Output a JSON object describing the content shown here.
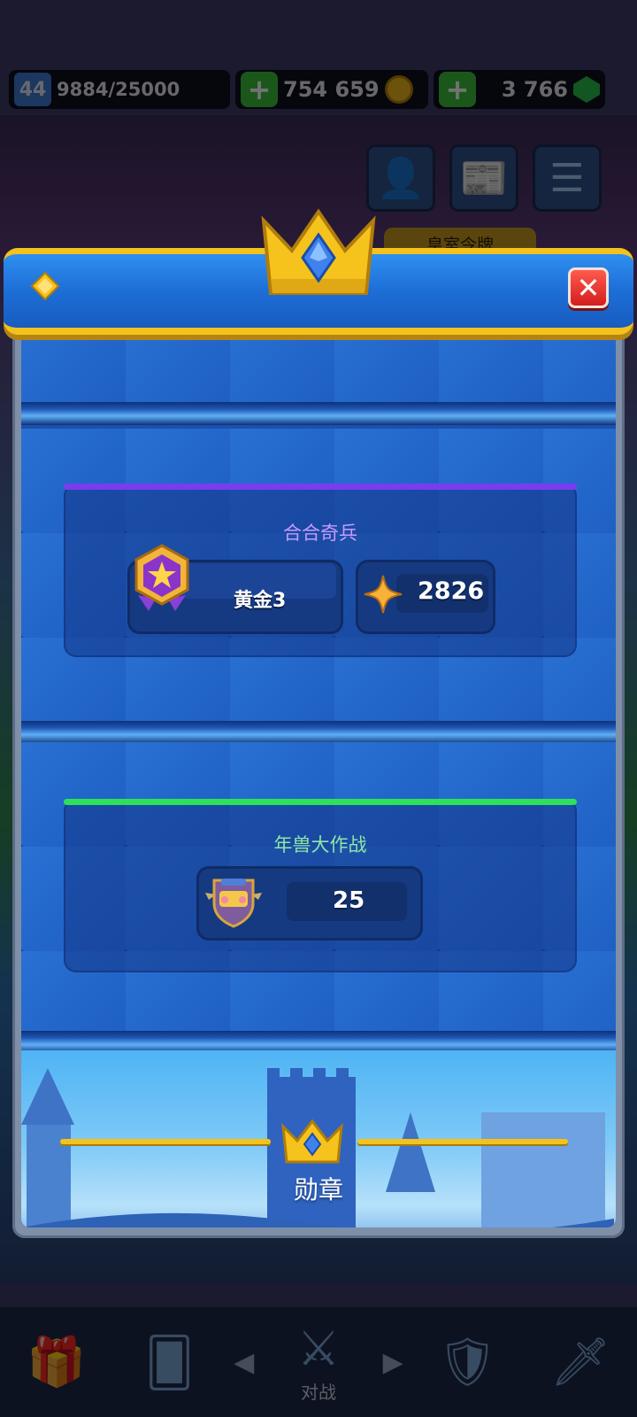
{
  "hud": {
    "level": "44",
    "xp": "9884/25000",
    "gold": "754 659",
    "gems": "3 766",
    "plus_label": "+",
    "plus_label_2": "+"
  },
  "background": {
    "tab_label": "皇室令牌",
    "nav_battle_label": "对战"
  },
  "icons": {
    "header": "diamond-gem-icon",
    "crown": "crown-icon",
    "close": "close-icon",
    "medal": "star-medal-icon",
    "trophy_star": "four-point-star-icon",
    "shield_badge": "shield-badge-icon"
  },
  "modal": {
    "close_label": "✕",
    "sections": [
      {
        "title": "合合奇兵",
        "accent": "#7a3cf0",
        "title_color": "#c69bff",
        "rank": "黄金3",
        "score": "2826"
      },
      {
        "title": "年兽大作战",
        "accent": "#2de25a",
        "title_color": "#8fe6a6",
        "score": "25"
      }
    ],
    "footer_label": "勋章"
  },
  "colors": {
    "gold_trim": "#f3c21c",
    "header_blue": "#1d6ed6",
    "close_red": "#d21e1e"
  }
}
